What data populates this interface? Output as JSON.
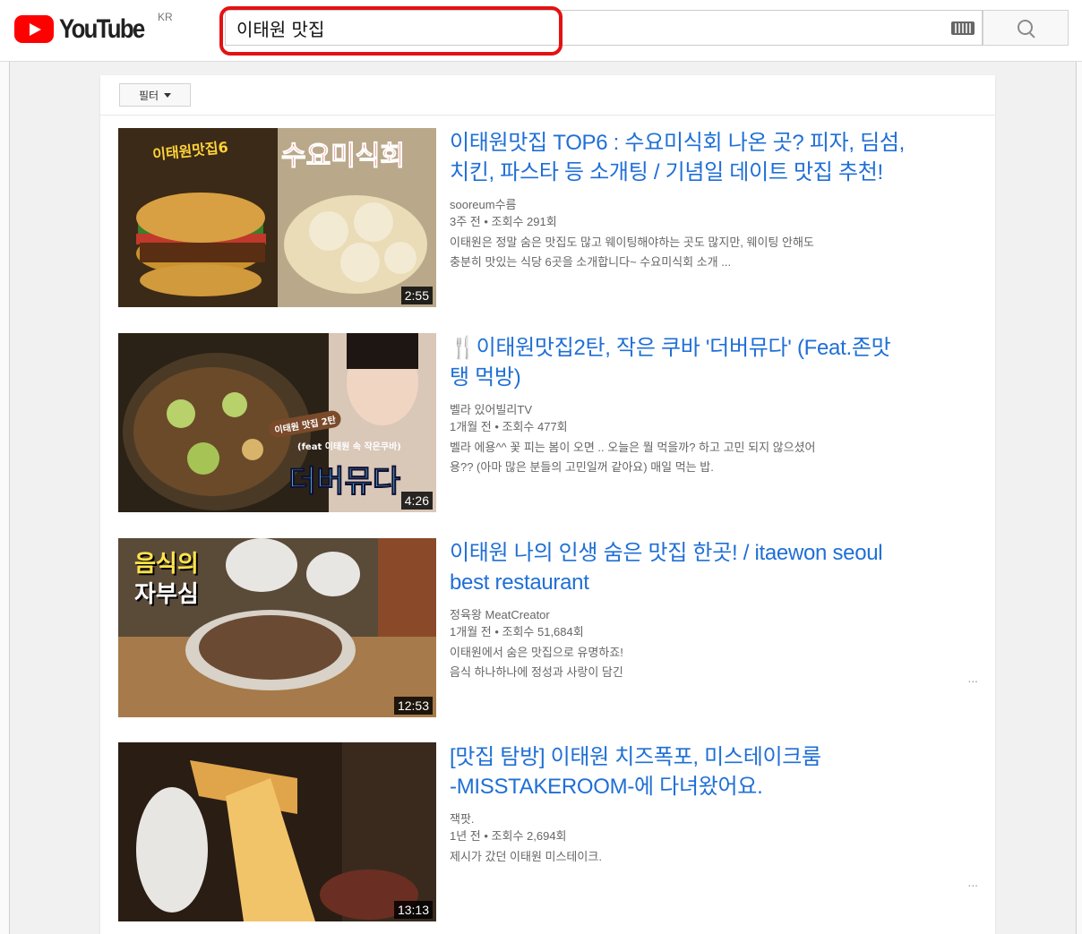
{
  "header": {
    "logo_text": "YouTube",
    "country_code": "KR",
    "search_value": "이태원 맛집",
    "keyboard_icon": "keyboard-icon",
    "search_icon": "search-icon"
  },
  "filter": {
    "label": "필터"
  },
  "results": [
    {
      "title_line1": "이태원맛집 TOP6 : 수요미식회 나온 곳? 피자, 딤섬,",
      "title_line2": "치킨, 파스타 등 소개팅 / 기념일 데이트 맛집 추천!",
      "channel": "sooreum수름",
      "stats": "3주 전 • 조회수 291회",
      "desc_line1": "이태원은 정말 숨은 맛집도 많고 웨이팅해야하는 곳도 많지만, 웨이팅 안해도",
      "desc_line2": "충분히 맛있는 식당 6곳을 소개합니다~ 수요미식회 소개 ...",
      "duration": "2:55",
      "thumb_text_a": "이태원맛집6",
      "thumb_text_b": "수요미식회"
    },
    {
      "title_line1": "🍴이태원맛집2탄, 작은 쿠바 '더버뮤다' (Feat.존맛",
      "title_line2": "탱 먹방)",
      "channel": "벨라 있어빌리TV",
      "stats": "1개월 전 • 조회수 477회",
      "desc_line1": "벨라 에용^^ 꽃 피는 봄이 오면 .. 오늘은 뭘 먹을까? 하고 고민 되지 않으셨어",
      "desc_line2": "용?? (아마 많은 분들의 고민일꺼 같아요) 매일 먹는 밥.",
      "duration": "4:26",
      "thumb_text_a": "이태원 맛집 2탄",
      "thumb_text_b": "(feat 이태원 속 작은쿠바)",
      "thumb_text_c": "더버뮤다"
    },
    {
      "title_line1": "이태원 나의 인생 숨은 맛집 한곳! / itaewon seoul",
      "title_line2": "best restaurant",
      "channel": "정육왕 MeatCreator",
      "stats": "1개월 전 • 조회수 51,684회",
      "desc_line1": "이태원에서 숨은 맛집으로 유명하죠!",
      "desc_line2": "음식 하나하나에 정성과 사랑이 담긴",
      "more": "...",
      "duration": "12:53",
      "thumb_text_a": "음식의",
      "thumb_text_b": "자부심"
    },
    {
      "title_line1": "[맛집 탐방] 이태원 치즈폭포, 미스테이크룸",
      "title_line2": "-MISSTAKEROOM-에 다녀왔어요.",
      "channel": "잭팟.",
      "stats": "1년 전 • 조회수 2,694회",
      "desc_line1": "제시가 갔던 이태원 미스테이크.",
      "desc_line2": "",
      "more": "...",
      "duration": "13:13"
    }
  ]
}
